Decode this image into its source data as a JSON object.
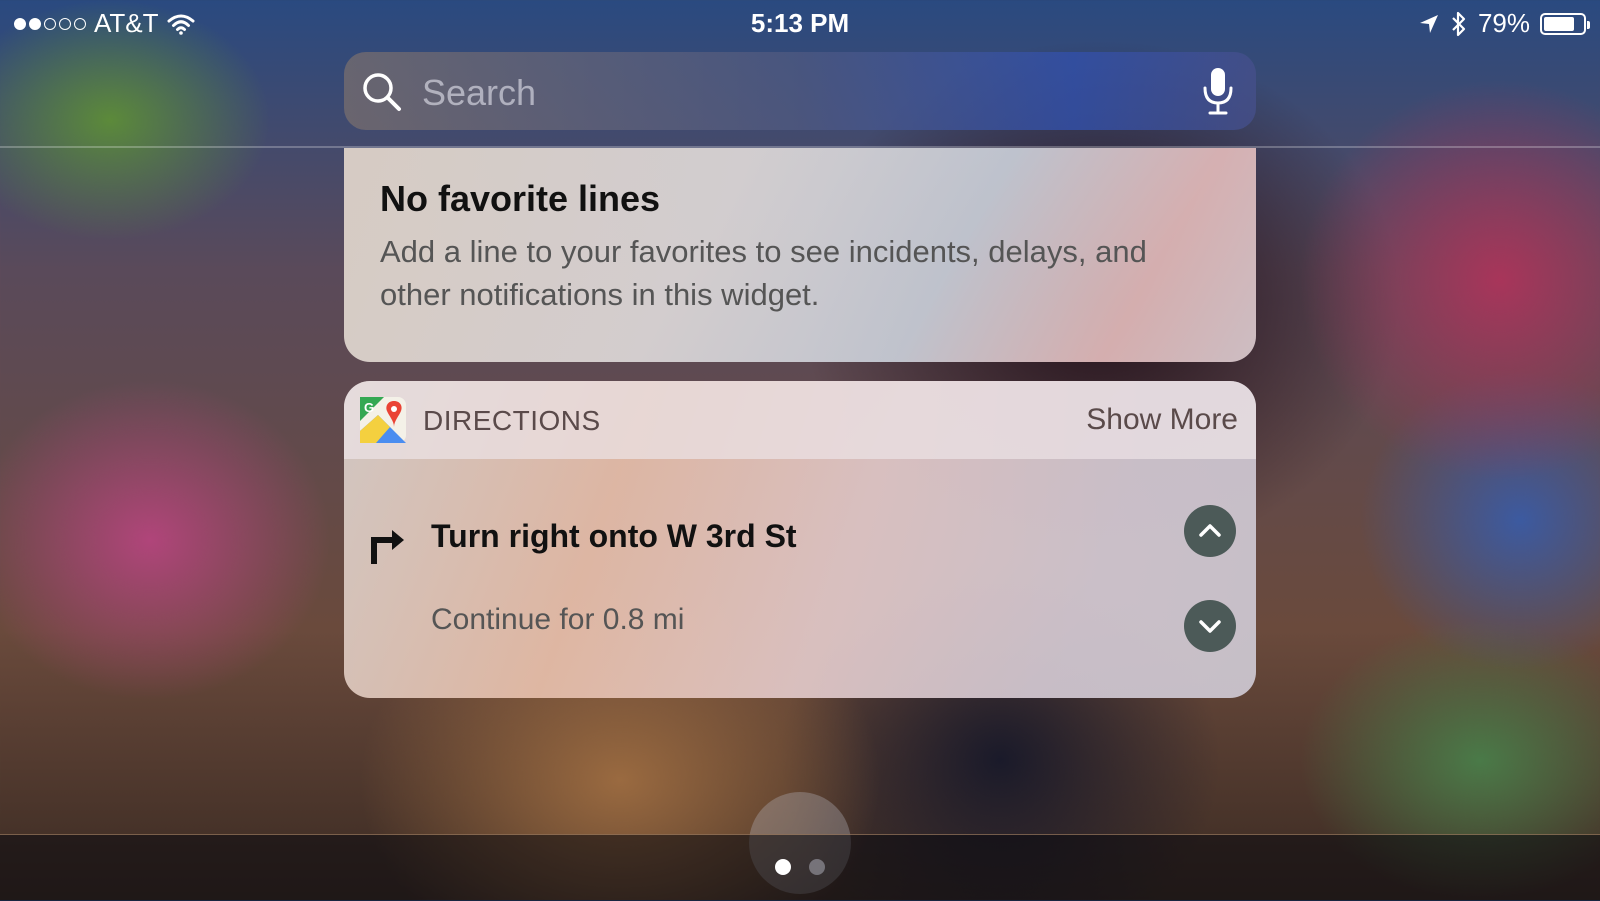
{
  "status_bar": {
    "carrier": "AT&T",
    "time": "5:13 PM",
    "battery_percent": "79%",
    "battery_level": 0.79,
    "signal_bars": 2,
    "signal_total": 5
  },
  "search": {
    "placeholder": "Search",
    "icons": [
      "search-icon",
      "microphone-icon"
    ]
  },
  "favorites_widget": {
    "title": "No favorite lines",
    "body": "Add a line to your favorites to see incidents, delays, and other notifications in this widget."
  },
  "directions_widget": {
    "header_title": "DIRECTIONS",
    "show_more_label": "Show More",
    "app_icon": "google-maps-icon",
    "step": "Turn right onto W 3rd St",
    "step_detail": "Continue for 0.8 mi",
    "step_icon": "turn-right-icon"
  },
  "page_indicator": {
    "count": 2,
    "active_index": 0
  },
  "colors": {
    "circle_button": "#4c5a58",
    "header_text": "#5a4a4a"
  }
}
